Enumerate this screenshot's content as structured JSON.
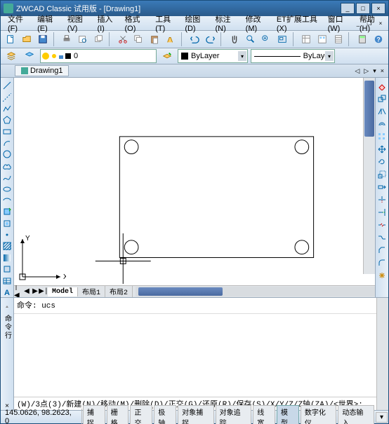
{
  "title": "ZWCAD Classic 试用版 - [Drawing1]",
  "menus": [
    "文件(F)",
    "编辑(E)",
    "视图(V)",
    "插入(I)",
    "格式(O)",
    "工具(T)",
    "绘图(D)",
    "标注(N)",
    "修改(M)",
    "ET扩展工具(X)",
    "窗口(W)",
    "帮助(H)"
  ],
  "doc_tab": "Drawing1",
  "layer_name": "0",
  "color_by": "ByLayer",
  "lineweight_by": "ByLayer",
  "model_tabs": {
    "nav": [
      "|◀",
      "◀",
      "▶",
      "▶|"
    ],
    "tabs": [
      "Model",
      "布局1",
      "布局2"
    ]
  },
  "cmd_hist": "命令: ucs",
  "cmd_handle": "命令行",
  "cmd_prompt": "(W)/3点(3)/新建(N)/移动(M)/删除(D)/正交(G)/还原(R)/保存(S)/X/Y/Z/Z轴(ZA)/<世界>:",
  "coords": "145.0626, 98.2623, 0",
  "status_buttons": [
    "捕捉",
    "栅格",
    "正交",
    "极轴",
    "对象捕捉",
    "对象追踪",
    "线宽",
    "模型",
    "数字化仪",
    "动态输入"
  ],
  "status_active": "模型",
  "ucs_labels": {
    "x": "X",
    "y": "Y"
  }
}
